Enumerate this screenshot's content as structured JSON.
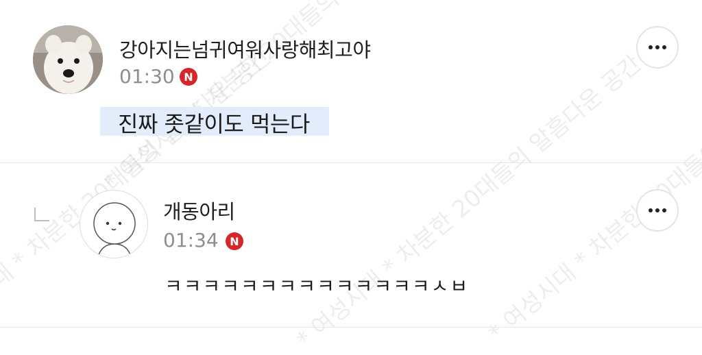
{
  "comments": [
    {
      "username": "강아지는넘귀여워사랑해최고야",
      "time": "01:30",
      "badge": "N",
      "content": "진짜 좃같이도 먹는다",
      "more": "more-options"
    },
    {
      "username": "개동아리",
      "time": "01:34",
      "badge": "N",
      "content": "ㅋㅋㅋㅋㅋㅋㅋㅋㅋㅋㅋㅋㅋㅋㅅㅂ",
      "more": "more-options"
    }
  ],
  "watermark": "* 여성시대 * 차분한 20대들의 알흠다운 공간",
  "colors": {
    "badge": "#d6262a",
    "highlight": "#e3ecfa",
    "time": "#8e8e8e"
  },
  "icons": {
    "reply": "reply-arrow-icon",
    "more": "ellipsis-icon",
    "badge": "new-badge-icon"
  }
}
